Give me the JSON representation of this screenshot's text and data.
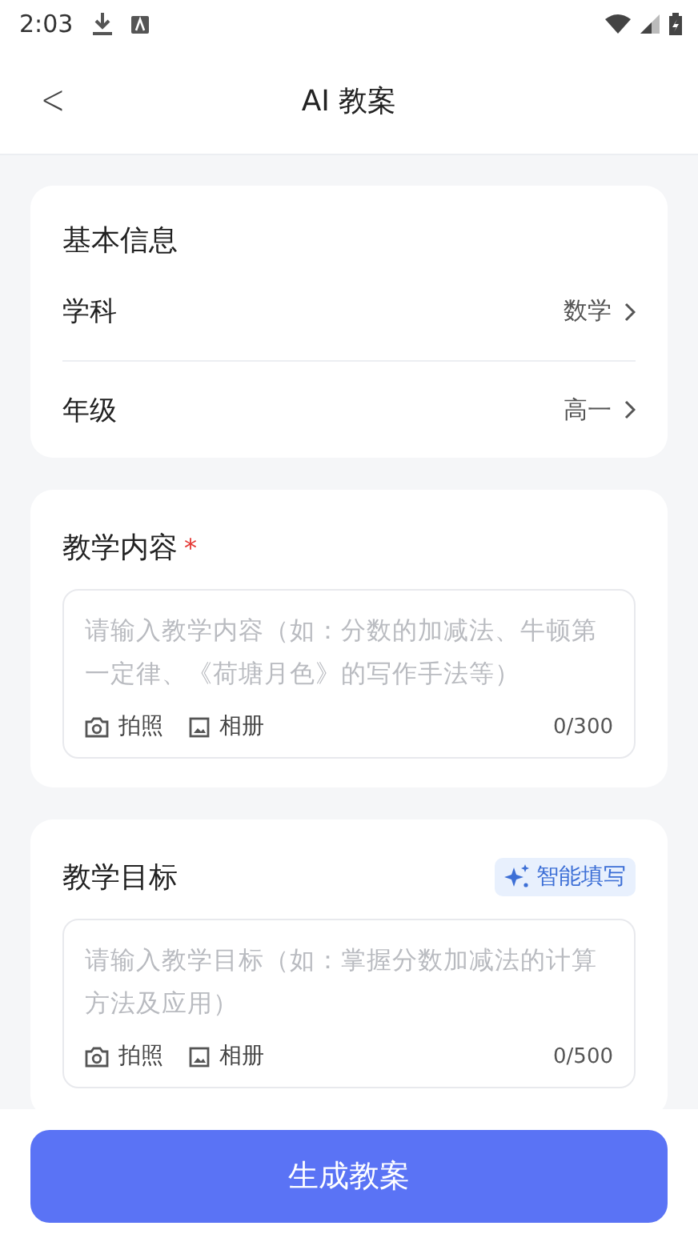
{
  "status_bar": {
    "time": "2:03"
  },
  "header": {
    "back": "<",
    "title": "AI 教案"
  },
  "basic_info": {
    "title": "基本信息",
    "rows": [
      {
        "label": "学科",
        "value": "数学"
      },
      {
        "label": "年级",
        "value": "高一"
      }
    ]
  },
  "sections": [
    {
      "title": "教学内容",
      "required_mark": "*",
      "placeholder": "请输入教学内容（如：分数的加减法、牛顿第一定律、《荷塘月色》的写作手法等）",
      "photo": "拍照",
      "album": "相册",
      "count": "0/300"
    },
    {
      "title": "教学目标",
      "ai_fill": "智能填写",
      "placeholder": "请输入教学目标（如：掌握分数加减法的计算方法及应用）",
      "photo": "拍照",
      "album": "相册",
      "count": "0/500"
    }
  ],
  "primary_button": "生成教案"
}
